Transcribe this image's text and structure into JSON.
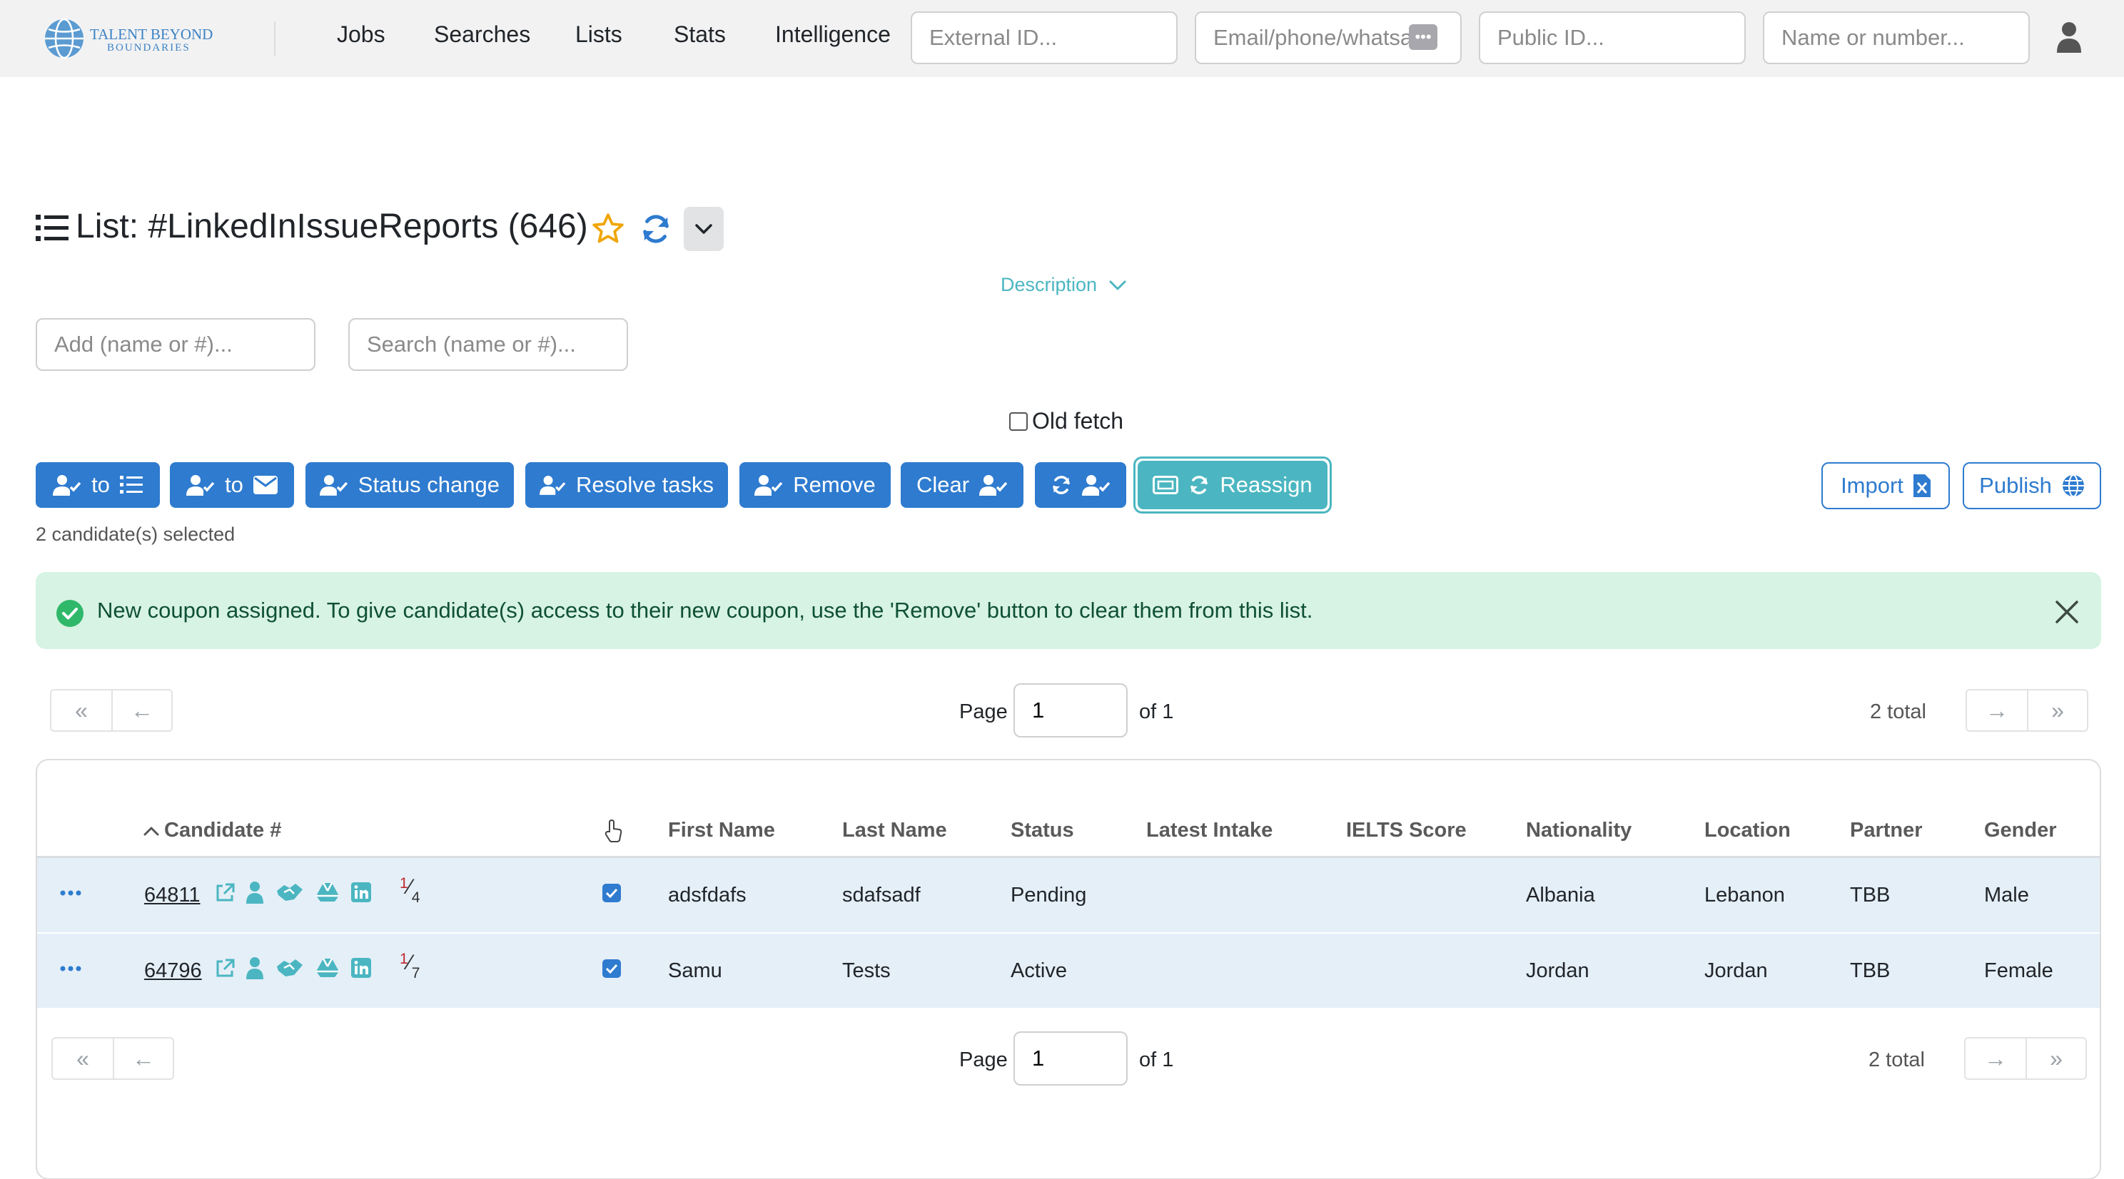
{
  "brand": {
    "line1": "TALENT BEYOND",
    "line2": "BOUNDARIES"
  },
  "nav": {
    "links": [
      "Jobs",
      "Searches",
      "Lists",
      "Stats",
      "Intelligence"
    ],
    "placeholders": {
      "external_id": "External ID...",
      "email": "Email/phone/whatsapp",
      "public_id": "Public ID...",
      "name": "Name or number..."
    }
  },
  "list": {
    "title": "List: #LinkedInIssueReports (646)",
    "description_label": "Description"
  },
  "inputs": {
    "add_placeholder": "Add (name or #)...",
    "search_placeholder": "Search (name or #)..."
  },
  "old_fetch_label": "Old fetch",
  "actions": {
    "to_list": "to",
    "to_email": "to",
    "status_change": "Status change",
    "resolve_tasks": "Resolve tasks",
    "remove": "Remove",
    "clear": "Clear",
    "reassign": "Reassign",
    "import": "Import",
    "publish": "Publish"
  },
  "selection_text": "2 candidate(s) selected",
  "alert": {
    "message": "New coupon assigned. To give candidate(s) access to their new coupon, use the 'Remove' button to clear them from this list."
  },
  "pagination": {
    "page_label": "Page",
    "page_value": "1",
    "of_label": "of 1",
    "total": "2 total"
  },
  "table": {
    "headers": {
      "candidate": "Candidate #",
      "first_name": "First Name",
      "last_name": "Last Name",
      "status": "Status",
      "latest_intake": "Latest Intake",
      "ielts": "IELTS Score",
      "nationality": "Nationality",
      "location": "Location",
      "partner": "Partner",
      "gender": "Gender"
    },
    "rows": [
      {
        "candidate": "64811",
        "count_num": "1",
        "count_den": "4",
        "first_name": "adsfdafs",
        "last_name": "sdafsadf",
        "status": "Pending",
        "latest_intake": "",
        "ielts": "",
        "nationality": "Albania",
        "location": "Lebanon",
        "partner": "TBB",
        "gender": "Male",
        "selected": true
      },
      {
        "candidate": "64796",
        "count_num": "1",
        "count_den": "7",
        "first_name": "Samu",
        "last_name": "Tests",
        "status": "Active",
        "latest_intake": "",
        "ielts": "",
        "nationality": "Jordan",
        "location": "Jordan",
        "partner": "TBB",
        "gender": "Female",
        "selected": true
      }
    ]
  },
  "colors": {
    "primary": "#2e7bcf",
    "teal": "#4bb6c1",
    "alert_bg": "#d7f3e3",
    "alert_text": "#0f5132",
    "row_bg": "#e5eff8",
    "star": "#f0a500"
  }
}
